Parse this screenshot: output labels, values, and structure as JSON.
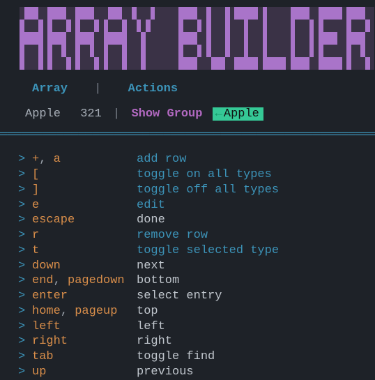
{
  "title_text": "ARRAY BUILDER",
  "menu": {
    "array": "Array",
    "sep": "|",
    "actions": "Actions"
  },
  "crumbs": {
    "name": "Apple",
    "count": "321",
    "sep": "|",
    "show_group": "Show Group",
    "tag_icon": "←",
    "tag_label": "Apple"
  },
  "divider": "══════════════════════════════════════════════════════════════════════",
  "gt": ">",
  "comma": ",",
  "rows": [
    {
      "keys": [
        "+",
        "a"
      ],
      "action": "add row",
      "link": true
    },
    {
      "keys": [
        "["
      ],
      "action": "toggle on all types",
      "link": true
    },
    {
      "keys": [
        "]"
      ],
      "action": "toggle off all types",
      "link": true
    },
    {
      "keys": [
        "e"
      ],
      "action": "edit",
      "link": true
    },
    {
      "keys": [
        "escape"
      ],
      "action": "done",
      "link": false
    },
    {
      "keys": [
        "r"
      ],
      "action": "remove row",
      "link": true
    },
    {
      "keys": [
        "t"
      ],
      "action": "toggle selected type",
      "link": true
    },
    {
      "keys": [
        "down"
      ],
      "action": "next",
      "link": false
    },
    {
      "keys": [
        "end",
        "pagedown"
      ],
      "action": "bottom",
      "link": false
    },
    {
      "keys": [
        "enter"
      ],
      "action": "select entry",
      "link": false
    },
    {
      "keys": [
        "home",
        "pageup"
      ],
      "action": "top",
      "link": false
    },
    {
      "keys": [
        "left"
      ],
      "action": "left",
      "link": false
    },
    {
      "keys": [
        "right"
      ],
      "action": "right",
      "link": false
    },
    {
      "keys": [
        "tab"
      ],
      "action": "toggle find",
      "link": false
    },
    {
      "keys": [
        "up"
      ],
      "action": "previous",
      "link": false
    }
  ]
}
